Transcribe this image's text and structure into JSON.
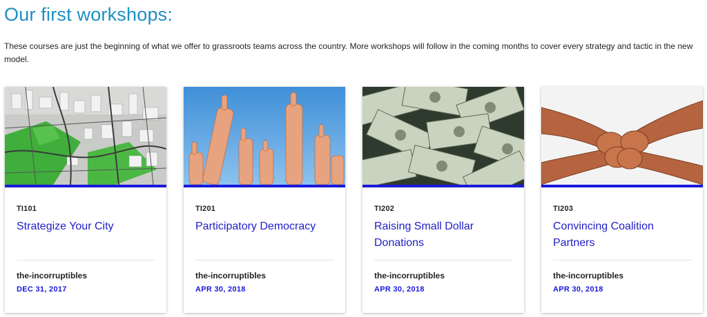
{
  "page": {
    "heading": "Our first workshops:",
    "intro": "These courses are just the beginning of what we offer to grassroots teams across the country. More workshops will follow in the coming months to cover every strategy and tactic in the new model."
  },
  "colors": {
    "heading": "#1e8fc2",
    "link": "#2020c8",
    "accent": "#1a1adb"
  },
  "cards": [
    {
      "code": "TI101",
      "title": "Strategize Your City",
      "author": "the-incorruptibles",
      "date": "DEC 31, 2017",
      "image": "aerial-city-map-image"
    },
    {
      "code": "TI201",
      "title": "Participatory Democracy",
      "author": "the-incorruptibles",
      "date": "APR 30, 2018",
      "image": "thumbs-up-hands-image"
    },
    {
      "code": "TI202",
      "title": "Raising Small Dollar Donations",
      "author": "the-incorruptibles",
      "date": "APR 30, 2018",
      "image": "dollar-bills-image"
    },
    {
      "code": "TI203",
      "title": "Convincing Coalition Partners",
      "author": "the-incorruptibles",
      "date": "APR 30, 2018",
      "image": "linked-arms-image"
    }
  ]
}
